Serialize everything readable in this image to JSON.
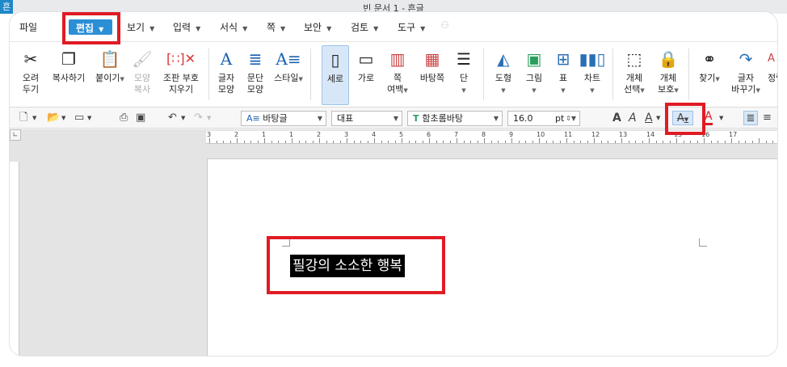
{
  "app": {
    "icon_glyph": "흔",
    "window_title": "빈 문서 1 - 흔글"
  },
  "menubar": {
    "items": [
      {
        "label": "파일"
      },
      {
        "label": "편집"
      },
      {
        "label": "보기"
      },
      {
        "label": "입력"
      },
      {
        "label": "서식"
      },
      {
        "label": "쪽"
      },
      {
        "label": "보안"
      },
      {
        "label": "검토"
      },
      {
        "label": "도구"
      }
    ]
  },
  "ribbon": {
    "cut": {
      "line1": "오려",
      "line2": "두기"
    },
    "copy": {
      "line1": "복사하기"
    },
    "paste": {
      "line1": "붙이기"
    },
    "format_copy": {
      "line1": "모양",
      "line2": "복사"
    },
    "clear_format": {
      "line1": "조판 부호",
      "line2": "지우기"
    },
    "char_shape": {
      "line1": "글자",
      "line2": "모양"
    },
    "para_shape": {
      "line1": "문단",
      "line2": "모양"
    },
    "style": {
      "line1": "스타일"
    },
    "portrait": {
      "line1": "세로"
    },
    "landscape": {
      "line1": "가로"
    },
    "page_margin": {
      "line1": "쪽",
      "line2": "여백"
    },
    "background": {
      "line1": "바탕쪽"
    },
    "columns": {
      "line1": "단"
    },
    "shape": {
      "line1": "도형"
    },
    "picture": {
      "line1": "그림"
    },
    "table": {
      "line1": "표"
    },
    "chart": {
      "line1": "차트"
    },
    "object_select": {
      "line1": "개체",
      "line2": "선택"
    },
    "object_protect": {
      "line1": "개체",
      "line2": "보호"
    },
    "find": {
      "line1": "찾기"
    },
    "replace": {
      "line1": "글자",
      "line2": "바꾸기"
    },
    "sort": {
      "line1": "정렬"
    }
  },
  "toolbar": {
    "style_combo": "바탕글",
    "lang_combo": "대표",
    "font_combo": "함초롬바탕",
    "size_value": "16.0",
    "size_unit": "pt"
  },
  "ruler": {
    "labels": [
      "3",
      "2",
      "1",
      "1",
      "2",
      "3",
      "4",
      "5",
      "6",
      "7",
      "8",
      "9",
      "10",
      "11",
      "12",
      "13",
      "14",
      "15",
      "16",
      "17"
    ]
  },
  "document": {
    "selected_text": "필강의 소소한 행복"
  },
  "colors": {
    "accent": "#2b8fd6",
    "highlight": "#e01b24",
    "font_color_bar": "#e01b24"
  }
}
